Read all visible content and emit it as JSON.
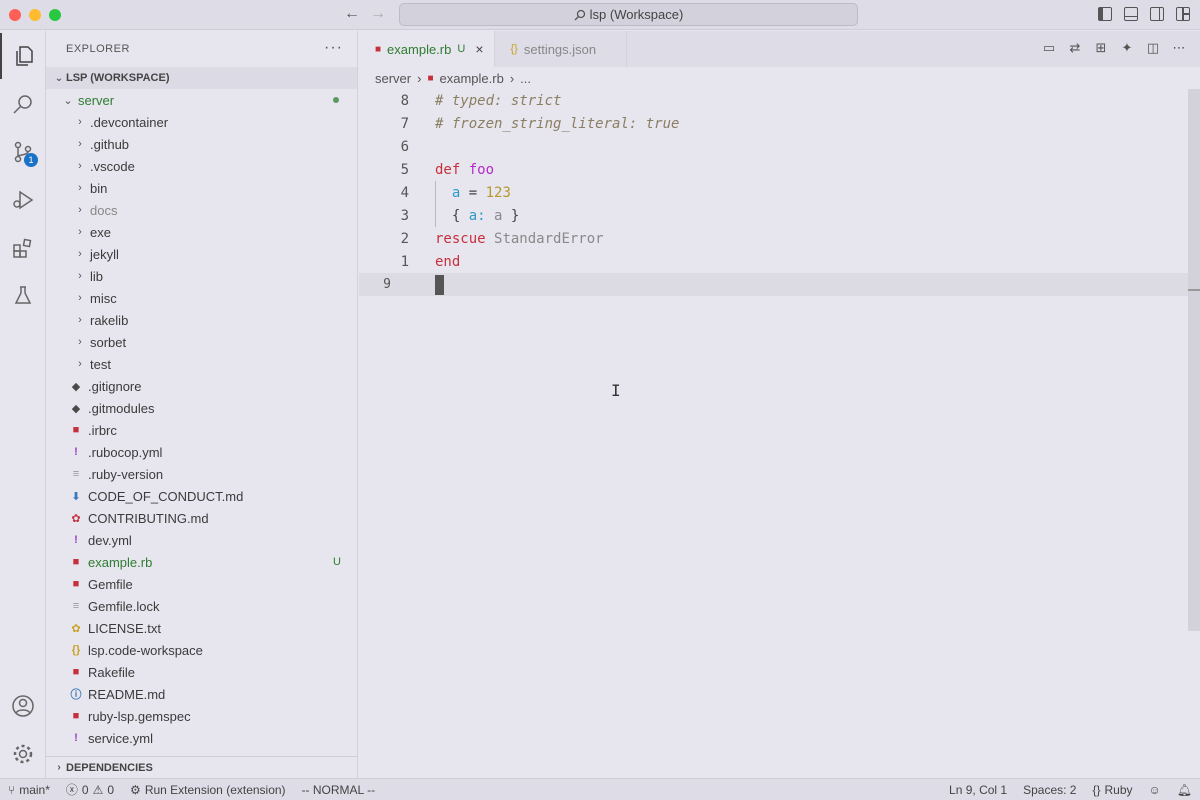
{
  "window": {
    "title": "lsp (Workspace)"
  },
  "activity": {
    "scm_badge": "1"
  },
  "explorer": {
    "header": "EXPLORER",
    "more": "···",
    "workspace": "LSP (WORKSPACE)",
    "root_folder": "server",
    "items": [
      {
        "label": ".devcontainer",
        "kind": "folder"
      },
      {
        "label": ".github",
        "kind": "folder"
      },
      {
        "label": ".vscode",
        "kind": "folder"
      },
      {
        "label": "bin",
        "kind": "folder"
      },
      {
        "label": "docs",
        "kind": "folder",
        "dim": true
      },
      {
        "label": "exe",
        "kind": "folder"
      },
      {
        "label": "jekyll",
        "kind": "folder"
      },
      {
        "label": "lib",
        "kind": "folder"
      },
      {
        "label": "misc",
        "kind": "folder"
      },
      {
        "label": "rakelib",
        "kind": "folder"
      },
      {
        "label": "sorbet",
        "kind": "folder"
      },
      {
        "label": "test",
        "kind": "folder"
      },
      {
        "label": ".gitignore",
        "kind": "file",
        "icon": "git-icon",
        "glyph": "◆",
        "color": "#4a4a4a"
      },
      {
        "label": ".gitmodules",
        "kind": "file",
        "icon": "git-icon",
        "glyph": "◆",
        "color": "#4a4a4a"
      },
      {
        "label": ".irbrc",
        "kind": "file",
        "icon": "ruby-icon",
        "glyph": "■",
        "color": "#c6303c"
      },
      {
        "label": ".rubocop.yml",
        "kind": "file",
        "icon": "yaml-icon",
        "glyph": "!",
        "color": "#9b3fc8"
      },
      {
        "label": ".ruby-version",
        "kind": "file",
        "icon": "text-icon",
        "glyph": "≡",
        "color": "#999999"
      },
      {
        "label": "CODE_OF_CONDUCT.md",
        "kind": "file",
        "icon": "download-icon",
        "glyph": "⬇",
        "color": "#3a7ab8"
      },
      {
        "label": "CONTRIBUTING.md",
        "kind": "file",
        "icon": "ribbon-icon",
        "glyph": "✿",
        "color": "#c6303c"
      },
      {
        "label": "dev.yml",
        "kind": "file",
        "icon": "yaml-icon",
        "glyph": "!",
        "color": "#9b3fc8"
      },
      {
        "label": "example.rb",
        "kind": "file",
        "icon": "ruby-icon",
        "glyph": "■",
        "color": "#c6303c",
        "modified": true,
        "deco": "U"
      },
      {
        "label": "Gemfile",
        "kind": "file",
        "icon": "ruby-icon",
        "glyph": "■",
        "color": "#c6303c"
      },
      {
        "label": "Gemfile.lock",
        "kind": "file",
        "icon": "text-icon",
        "glyph": "≡",
        "color": "#999999"
      },
      {
        "label": "LICENSE.txt",
        "kind": "file",
        "icon": "license-icon",
        "glyph": "✿",
        "color": "#c9a227"
      },
      {
        "label": "lsp.code-workspace",
        "kind": "file",
        "icon": "json-icon",
        "glyph": "{}",
        "color": "#c9a227"
      },
      {
        "label": "Rakefile",
        "kind": "file",
        "icon": "ruby-icon",
        "glyph": "■",
        "color": "#c6303c"
      },
      {
        "label": "README.md",
        "kind": "file",
        "icon": "info-icon",
        "glyph": "ⓘ",
        "color": "#3a7ab8"
      },
      {
        "label": "ruby-lsp.gemspec",
        "kind": "file",
        "icon": "ruby-icon",
        "glyph": "■",
        "color": "#c6303c"
      },
      {
        "label": "service.yml",
        "kind": "file",
        "icon": "yaml-icon",
        "glyph": "!",
        "color": "#9b3fc8"
      }
    ],
    "dependencies": "DEPENDENCIES"
  },
  "tabs": [
    {
      "label": "example.rb",
      "badge": "U",
      "active": true
    },
    {
      "label": "settings.json",
      "active": false
    }
  ],
  "breadcrumb": {
    "folder": "server",
    "file": "example.rb",
    "more": "..."
  },
  "code": {
    "lines": [
      {
        "num": "8"
      },
      {
        "num": "7"
      },
      {
        "num": "6"
      },
      {
        "num": "5"
      },
      {
        "num": "4"
      },
      {
        "num": "3"
      },
      {
        "num": "2"
      },
      {
        "num": "1"
      },
      {
        "num": "9"
      }
    ],
    "comment1": "# typed: strict",
    "comment2": "# frozen_string_literal: true",
    "kw_def": "def",
    "fn_name": "foo",
    "var_a": "a",
    "eq": "=",
    "num": "123",
    "brace_open": "{",
    "hash_key": "a:",
    "hash_val": "a",
    "brace_close": "}",
    "kw_rescue": "rescue",
    "const": "StandardError",
    "kw_end": "end"
  },
  "status": {
    "branch": "main*",
    "errors": "0",
    "warnings": "0",
    "run": "Run Extension (extension)",
    "mode": "-- NORMAL --",
    "position": "Ln 9, Col 1",
    "spaces": "Spaces: 2",
    "language": "Ruby"
  }
}
